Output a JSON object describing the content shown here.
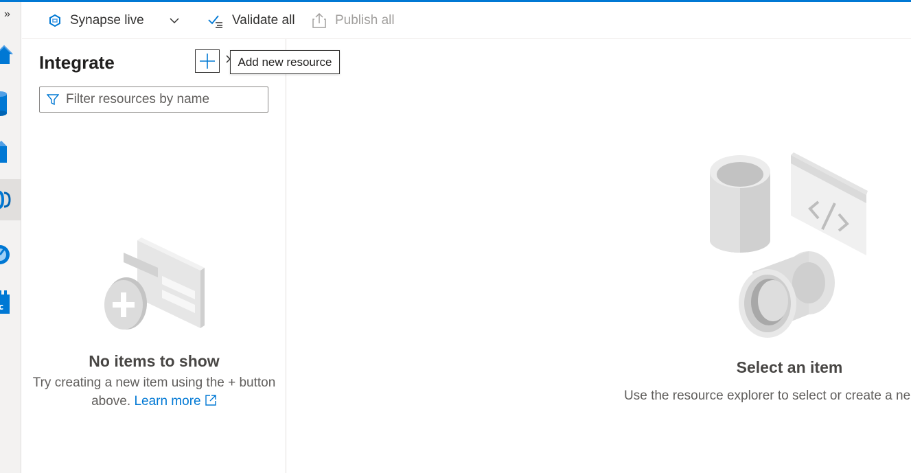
{
  "rail": {
    "expand_glyph": "»",
    "items": [
      {
        "icon": "home-icon",
        "color": "#0078d4"
      },
      {
        "icon": "data-icon",
        "color": "#0078d4"
      },
      {
        "icon": "develop-icon",
        "color": "#0078d4"
      },
      {
        "icon": "integrate-icon",
        "color": "#0078d4",
        "active": true
      },
      {
        "icon": "monitor-icon",
        "color": "#0078d4"
      },
      {
        "icon": "manage-icon",
        "color": "#0078d4"
      }
    ]
  },
  "toolbar": {
    "workspace_label": "Synapse live",
    "validate_label": "Validate all",
    "publish_label": "Publish all"
  },
  "panel": {
    "title": "Integrate",
    "filter_placeholder": "Filter resources by name",
    "empty_title": "No items to show",
    "empty_desc_line1": "Try creating a new item using the + button",
    "empty_desc_line2": "above.",
    "learn_more": "Learn more"
  },
  "tooltip": {
    "text": "Add new resource"
  },
  "main": {
    "title": "Select an item",
    "desc": "Use the resource explorer to select or create a ne"
  },
  "colors": {
    "accent": "#0078d4",
    "text": "#323130",
    "muted": "#605e5c"
  }
}
